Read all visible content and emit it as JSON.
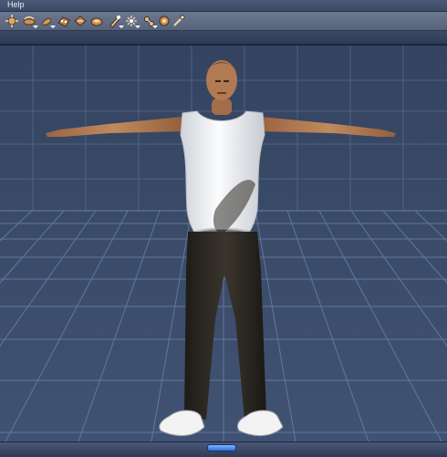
{
  "menubar": {
    "help_label": "Help"
  },
  "toolbar": {
    "tools": [
      {
        "icon": "rotate-tool-icon"
      },
      {
        "icon": "twist-tool-icon"
      },
      {
        "icon": "translate-tool-icon"
      },
      {
        "icon": "scale-tool-icon"
      },
      {
        "icon": "taper-tool-icon"
      },
      {
        "icon": "chain-break-tool-icon"
      },
      {
        "icon": "color-tool-icon"
      },
      {
        "icon": "grouping-tool-icon"
      },
      {
        "icon": "view-magnifier-tool-icon"
      },
      {
        "icon": "morph-tool-icon"
      },
      {
        "icon": "direct-manipulation-tool-icon"
      }
    ]
  },
  "viewport": {
    "figure": "female-3d-figure-t-pose",
    "colors": {
      "background": "#3a4b66",
      "grid": "#6d86ad",
      "skin": "#b27a52",
      "shirt": "#eef0f2",
      "pants": "#2a2620",
      "shoes": "#f2f2f2"
    }
  }
}
